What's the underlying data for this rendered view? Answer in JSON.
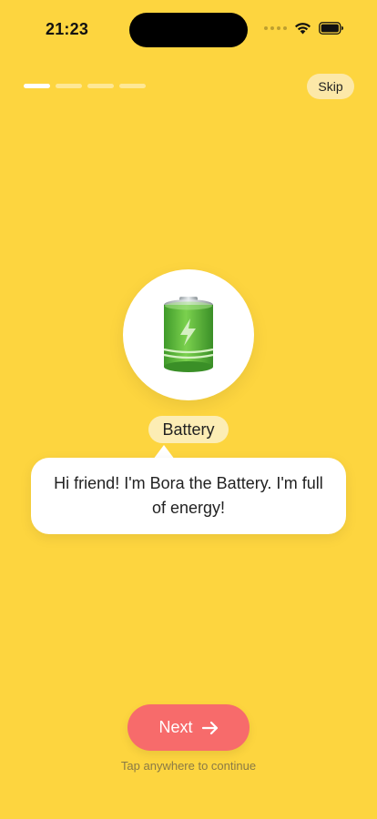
{
  "status_bar": {
    "time": "21:23",
    "icons": [
      "cellular-dots-icon",
      "wifi-icon",
      "battery-icon"
    ]
  },
  "onboarding": {
    "progress": {
      "total_steps": 4,
      "current_step": 1
    },
    "skip_label": "Skip",
    "character": {
      "icon": "battery-character-icon",
      "name": "Battery",
      "message": "Hi friend! I'm Bora the Battery. I'm full of energy!"
    },
    "next_label": "Next",
    "next_icon": "arrow-right-icon",
    "hint": "Tap anywhere to continue"
  },
  "colors": {
    "background": "#FDD53F",
    "next_button": "#F76B6B",
    "badge": "#FCEDB4",
    "skip_button": "#FCE8A8",
    "battery_green": "#5CB83C"
  }
}
